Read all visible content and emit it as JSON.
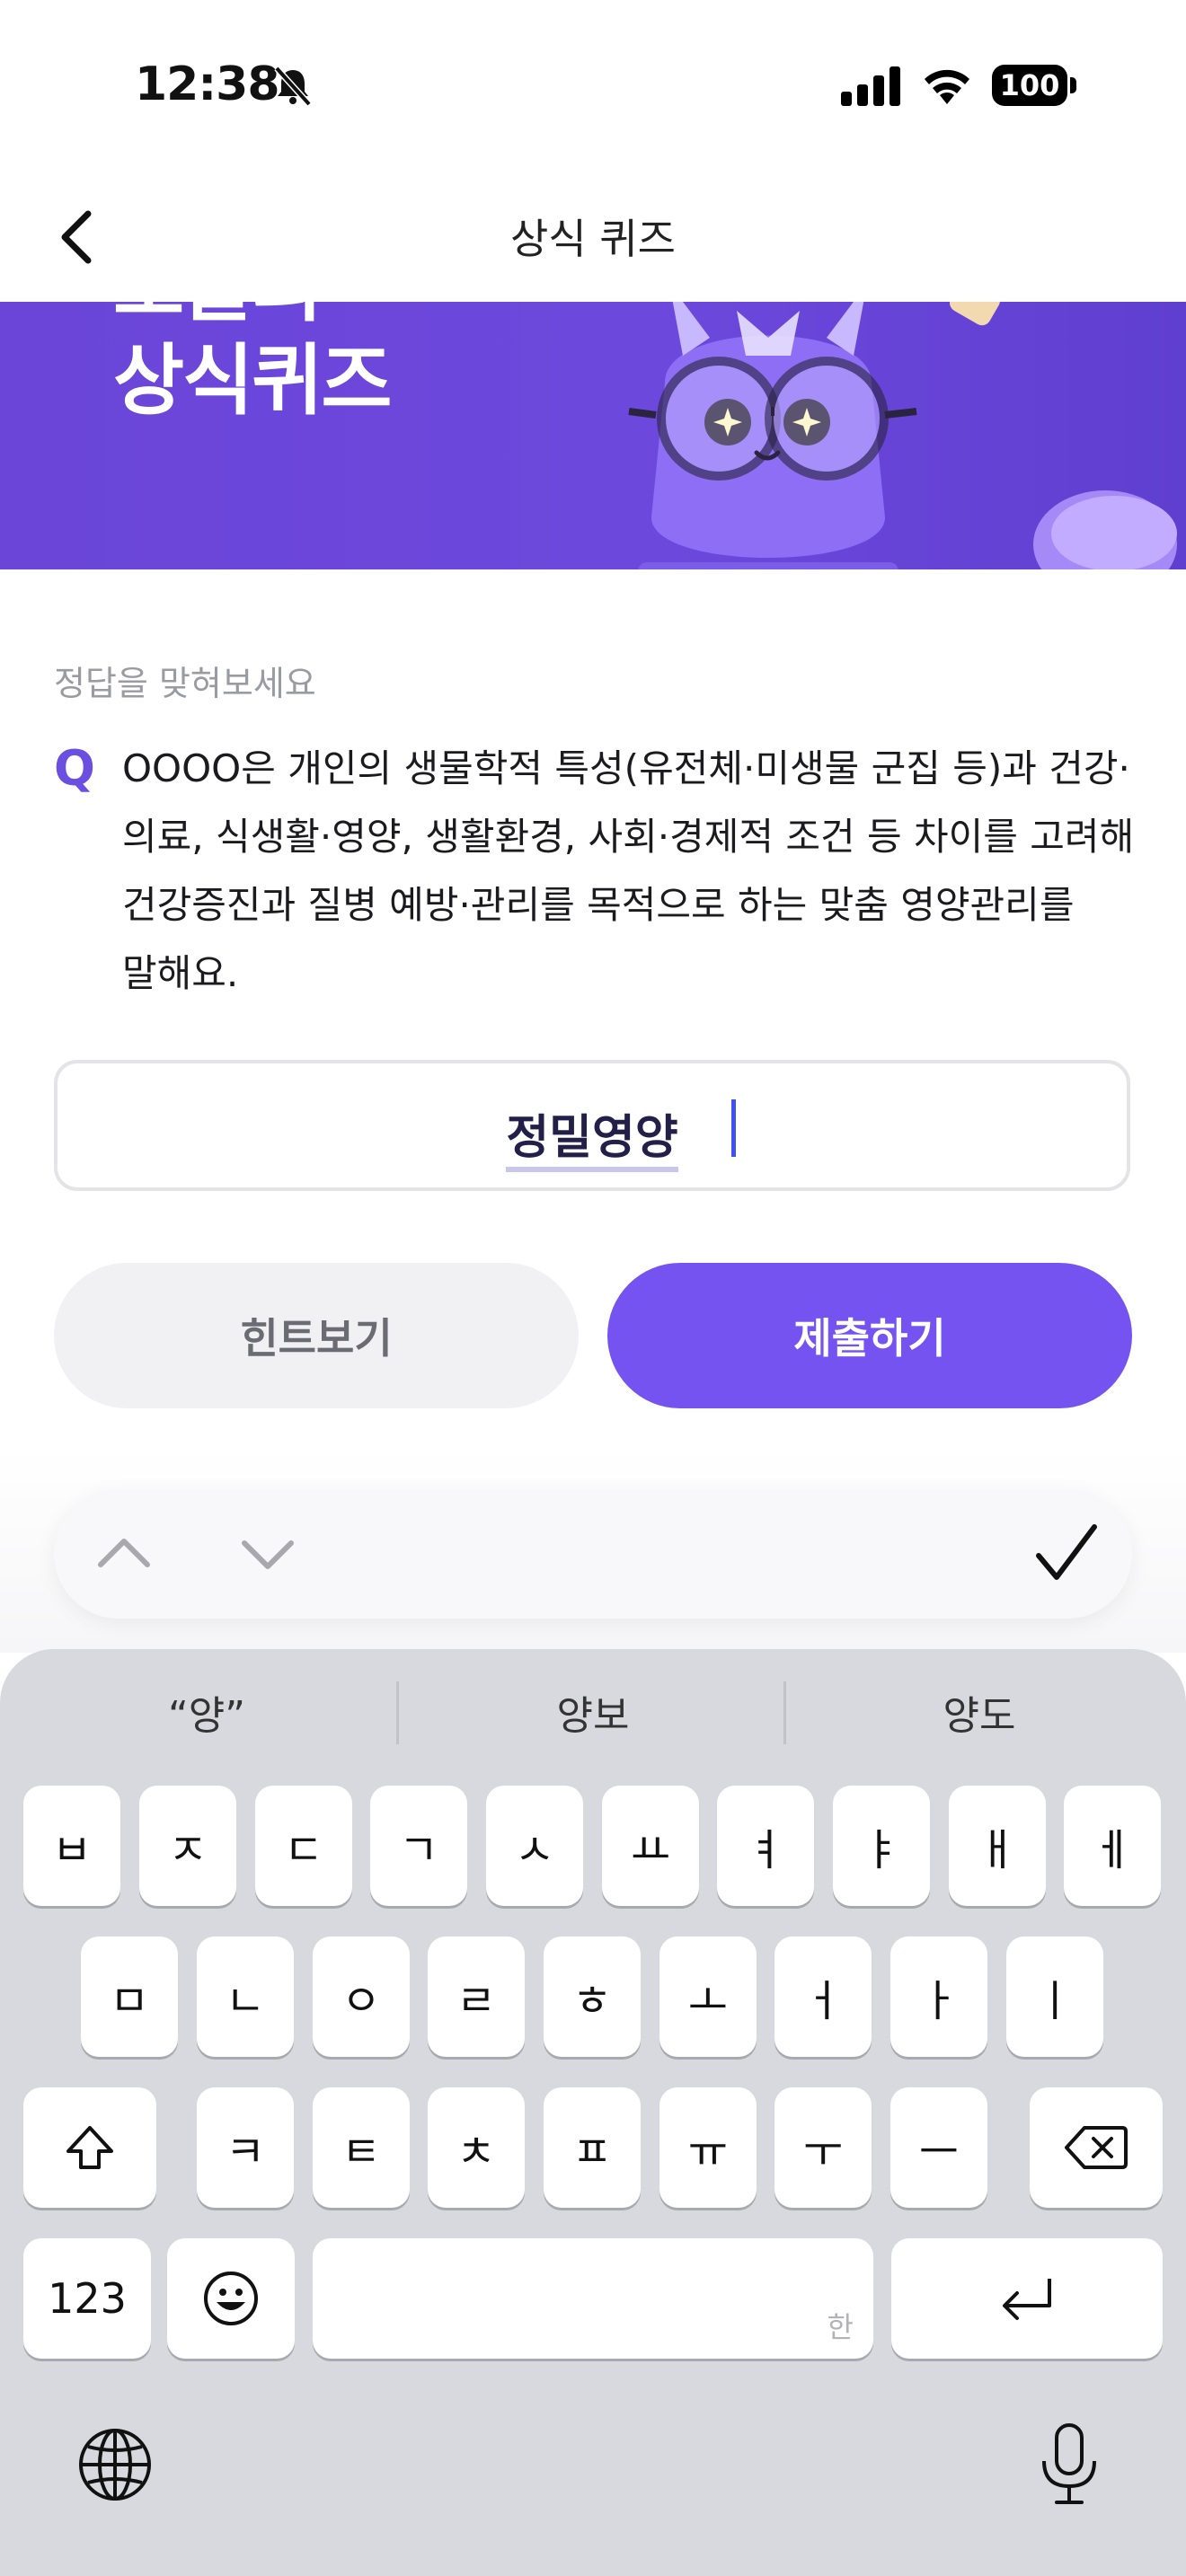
{
  "status_bar": {
    "time": "12:38",
    "battery": "100"
  },
  "nav": {
    "title": "상식 퀴즈"
  },
  "banner": {
    "title": "오늘의\n상식퀴즈"
  },
  "quiz": {
    "prompt": "정답을 맞혀보세요",
    "q_mark": "Q",
    "question": "OOOO은 개인의 생물학적 특성(유전체·미생물 군집 등)과 건강·의료, 식생활·영양, 생활환경, 사회·경제적 조건 등 차이를 고려해 건강증진과 질병 예방·관리를 목적으로 하는 맞춤 영양관리를 말해요.",
    "answer_value": "정밀영양"
  },
  "buttons": {
    "hint": "힌트보기",
    "submit": "제출하기"
  },
  "keyboard": {
    "suggestions": [
      "“양”",
      "양보",
      "양도"
    ],
    "row1": [
      "ㅂ",
      "ㅈ",
      "ㄷ",
      "ㄱ",
      "ㅅ",
      "ㅛ",
      "ㅕ",
      "ㅑ",
      "ㅐ",
      "ㅔ"
    ],
    "row2": [
      "ㅁ",
      "ㄴ",
      "ㅇ",
      "ㄹ",
      "ㅎ",
      "ㅗ",
      "ㅓ",
      "ㅏ",
      "ㅣ"
    ],
    "row3": [
      "ㅋ",
      "ㅌ",
      "ㅊ",
      "ㅍ",
      "ㅠ",
      "ㅜ",
      "ㅡ"
    ],
    "numbers_key": "123",
    "space_hint": "한"
  },
  "icons": {
    "bell": "bell-slash-icon",
    "signal": "cellular-signal-icon",
    "wifi": "wifi-icon",
    "back": "chevron-left-icon",
    "up": "chevron-up-icon",
    "down": "chevron-down-icon",
    "done": "checkmark-icon",
    "shift": "shift-icon",
    "delete": "delete-icon",
    "emoji": "emoji-icon",
    "return": "return-icon",
    "globe": "globe-icon",
    "mic": "microphone-icon"
  },
  "colors": {
    "accent": "#7553f0",
    "banner": "#6a45d8",
    "q_mark": "#6b4fe0",
    "caret": "#3d52f0"
  }
}
